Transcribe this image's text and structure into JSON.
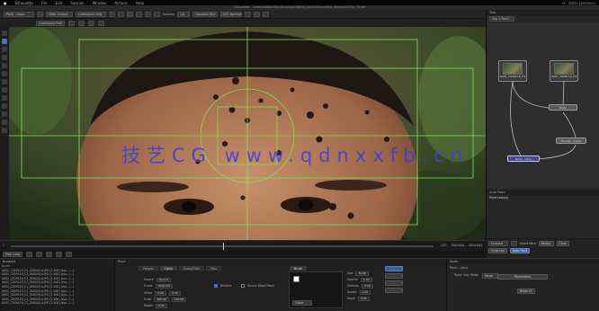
{
  "menubar": {
    "apple": "",
    "app_name": "Silhouette",
    "items": [
      "File",
      "Edit",
      "Session",
      "Window",
      "Actions",
      "Help"
    ],
    "right": "Katie Jamieson"
  },
  "window_title": "Silhouette - /Users/silhouette/Desktop/Digital_pencil/ShaneSilo_Sessions/Clip_10.sfx",
  "toolbar": {
    "view_select": "Paint - clone",
    "view_mode": "View: Output",
    "channel": "Luminance Only",
    "luminance": "Luminance Free",
    "gamma_label": "Gamma",
    "gamma_value": "1.0",
    "display": "Gaussian Blur",
    "lut": "LUT: Normal"
  },
  "viewer": {
    "watermark": "技艺CG  www.qdnxxfb.cn"
  },
  "timeline": {
    "start": "1",
    "current": "133",
    "end_a": "0001844",
    "end_b": "0001844",
    "playback": "Play Loop"
  },
  "tree_panel": {
    "title": "Tree",
    "display_select": "Clip 1 Point",
    "nodes": [
      {
        "label": "A001_C029119_C1"
      },
      {
        "label": "A001_C029119_C1"
      },
      {
        "label": "Ports"
      },
      {
        "label": "Tracker - Clone"
      },
      {
        "label": "Paint - clone"
      }
    ]
  },
  "autopaint": {
    "title": "Auto Paint",
    "items": [
      "Paint History"
    ],
    "controls": {
      "playback_select": "Forward",
      "insert_label": "Insert Here",
      "replay_label": "Replay",
      "clear_label": "Clear",
      "clear_list_label": "Clear List",
      "auto_paint_label": "Auto Paint"
    }
  },
  "browser": {
    "title": "Browser",
    "header": "Name",
    "files": [
      "A001_C029119_C1_0000(0).A.JPG [1-500] (sys.../...)",
      "A001_C029119_C1_0000(0).A.JPG [1-500] (sys.../...)",
      "A001_C029119_C1_0000(0).A.JPG [1-500] (sys.../...)",
      "A001_C029119_C1_0000(0).A.JPG [1-500] (sys.../...)",
      "A001_C029119_C1_0000(0).A.JPG [1-500] (sys.../...)",
      "A001_C029119_C1_0000(0).A.JPG [1-500] (sys.../...)",
      "A001_C029119_C1_0000(0).A.JPG [1-500] (sys.../...)",
      "A001_C029119_C1_0000(0).A.JPG [1-500] (sys.../...)",
      "A001_C029119_C1_0000(0).A.JPG [1-500] (sys.../...)",
      "A001_C029119_C1_0000(0).A.JPG [1-500] (sys.../...)"
    ]
  },
  "paint_panel": {
    "title": "Paint",
    "tabs": [
      "Presets",
      "Clone",
      "Grade/Filter",
      "Misc"
    ],
    "active_tab": "Clone",
    "source_label": "Source",
    "source_value": "Source",
    "frame_label": "Frame",
    "frame_value": "0000133",
    "offset_label": "Offset",
    "offset_values": [
      "0.00",
      "0.00"
    ],
    "scale_label": "Scale",
    "scale_values": [
      "100.00",
      "100.00"
    ],
    "rotate_label": "Rotate",
    "rotate_value": "0.00",
    "relative_label": "Relative",
    "source_wipe_label": "Source Wipe/Offset",
    "brush_tab": "Brush",
    "size_label": "Size",
    "size_value": "70.00",
    "opacity_label": "Opacity",
    "opacity_value": "1.00",
    "softness_label": "Softness",
    "softness_value": "0.50",
    "aspect_label": "Aspect",
    "aspect_value": "1.00",
    "angle_label": "Angle",
    "angle_value": "0.00",
    "brush_select": "Clone"
  },
  "node_panel": {
    "title": "Node",
    "name_label": "Paint - clone",
    "mode_label": "Point Only Mode",
    "mode_value": "Mode",
    "parameters_label": "Parameters",
    "reset_label": "Reset all"
  },
  "colors": {
    "accent": "#4a73b8",
    "guide": "#7ee05a",
    "watermark": "#3b3ee0",
    "node_selected": "#4a4a8a"
  }
}
